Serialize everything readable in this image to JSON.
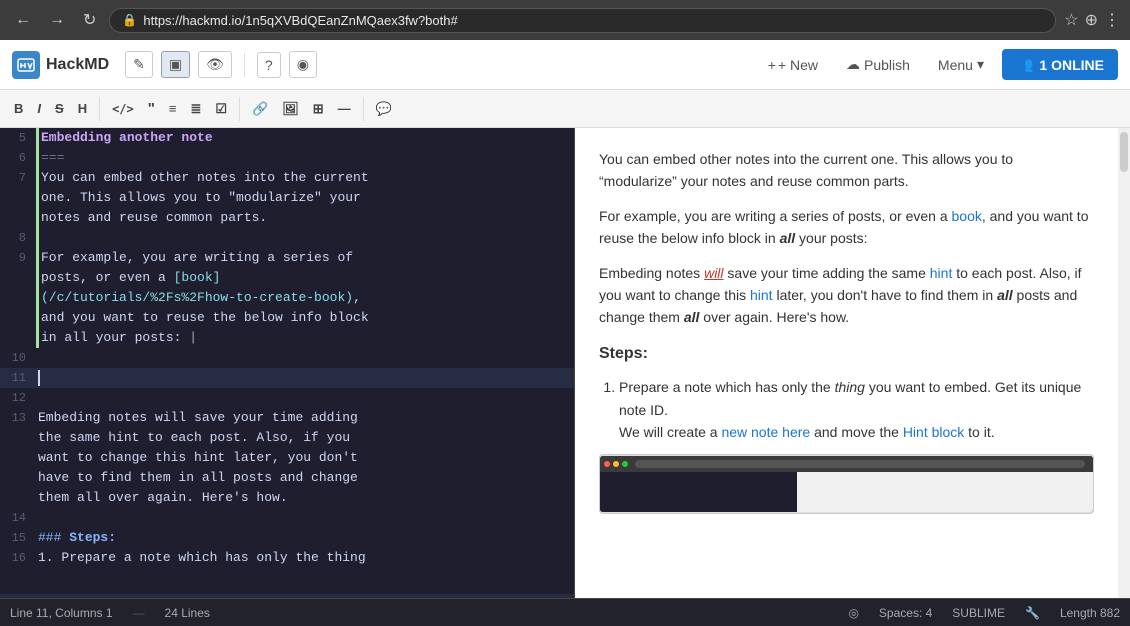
{
  "browser": {
    "url": "https://hackmd.io/1n5qXVBdQEanZnMQaex3fw?both#",
    "back_label": "←",
    "forward_label": "→",
    "refresh_label": "↻"
  },
  "appbar": {
    "logo": "HackMD",
    "edit_icon": "✎",
    "split_icon": "▣",
    "view_icon": "👁",
    "help_icon": "?",
    "camera_icon": "⊙",
    "new_label": "+ New",
    "publish_icon": "☁",
    "publish_label": "Publish",
    "menu_label": "Menu",
    "online_icon": "👥",
    "online_label": "1 ONLINE"
  },
  "editor_toolbar": {
    "bold": "B",
    "italic": "I",
    "strikethrough": "S",
    "heading": "H",
    "code_inline": "</>",
    "quote": "❝",
    "unordered_list": "≡",
    "ordered_list": "≣",
    "checklist": "☑",
    "link": "🔗",
    "image": "🖼",
    "table": "⊞",
    "hr": "—",
    "comment": "💬"
  },
  "editor": {
    "lines": [
      {
        "num": "5",
        "content": "Embedding another note",
        "type": "heading",
        "border": "green"
      },
      {
        "num": "6",
        "content": "===",
        "type": "sep",
        "border": "green"
      },
      {
        "num": "7",
        "content": "You can embed other notes into the current\none. This allows you to \"modularize\" your\nnotes and reuse common parts.",
        "type": "normal",
        "border": "green"
      },
      {
        "num": "8",
        "content": "",
        "type": "normal",
        "border": "green"
      },
      {
        "num": "9",
        "content": "For example, you are writing a series of\nposts, or even a [book]\n(/c/tutorials/%2Fs%2Fhow-to-create-book),\nand you want to reuse the below info block\nin all your posts:",
        "type": "mixed",
        "border": "green"
      },
      {
        "num": "10",
        "content": "",
        "type": "normal",
        "border": "none"
      },
      {
        "num": "11",
        "content": "",
        "type": "cursor",
        "border": "none"
      },
      {
        "num": "12",
        "content": "",
        "type": "normal",
        "border": "none"
      },
      {
        "num": "13",
        "content": "Embeding notes will save your time adding\nthe same hint to each post. Also, if you\nwant to change this hint later, you don't\nhave to find them in all posts and change\nthem all over again. Here's how.",
        "type": "normal",
        "border": "none"
      },
      {
        "num": "14",
        "content": "",
        "type": "normal",
        "border": "none"
      },
      {
        "num": "15",
        "content": "### Steps:",
        "type": "h3",
        "border": "none"
      },
      {
        "num": "16",
        "content": "1. Prepare a note which has only the thing",
        "type": "normal",
        "border": "none"
      }
    ]
  },
  "preview": {
    "para1": "You can embed other notes into the current one. This allows you to “modularize” your notes and reuse common parts.",
    "para2_pre": "For example, you are writing a series of posts, or even a ",
    "para2_link": "book",
    "para2_mid": ", and you want to reuse the below info block in ",
    "para2_all": "all",
    "para2_post": " your posts:",
    "para3_pre": "Embeding notes ",
    "para3_will": "will",
    "para3_mid": " save your time adding the same ",
    "para3_hint": "hint",
    "para3_to": " to each post. Also, if you want to change this ",
    "para3_hint2": "hint",
    "para3_later": " later, you",
    "para3_rest": " don’t have to find them in all posts and change them all over again. Here’s how.",
    "steps_heading": "Steps:",
    "step1_pre": "Prepare a note which has only the ",
    "step1_thing": "thing",
    "step1_post": " you want to embed. Get its unique note ID.",
    "step1_cont": "We will create a ",
    "step1_new": "new note here",
    "step1_cont2": " and move the ",
    "step1_hint": "Hint block",
    "step1_cont3": " to it."
  },
  "statusbar": {
    "line_col": "Line 11, Columns 1",
    "lines": "24 Lines",
    "spaces": "Spaces: 4",
    "mode": "SUBLIME",
    "length": "Length 882"
  }
}
